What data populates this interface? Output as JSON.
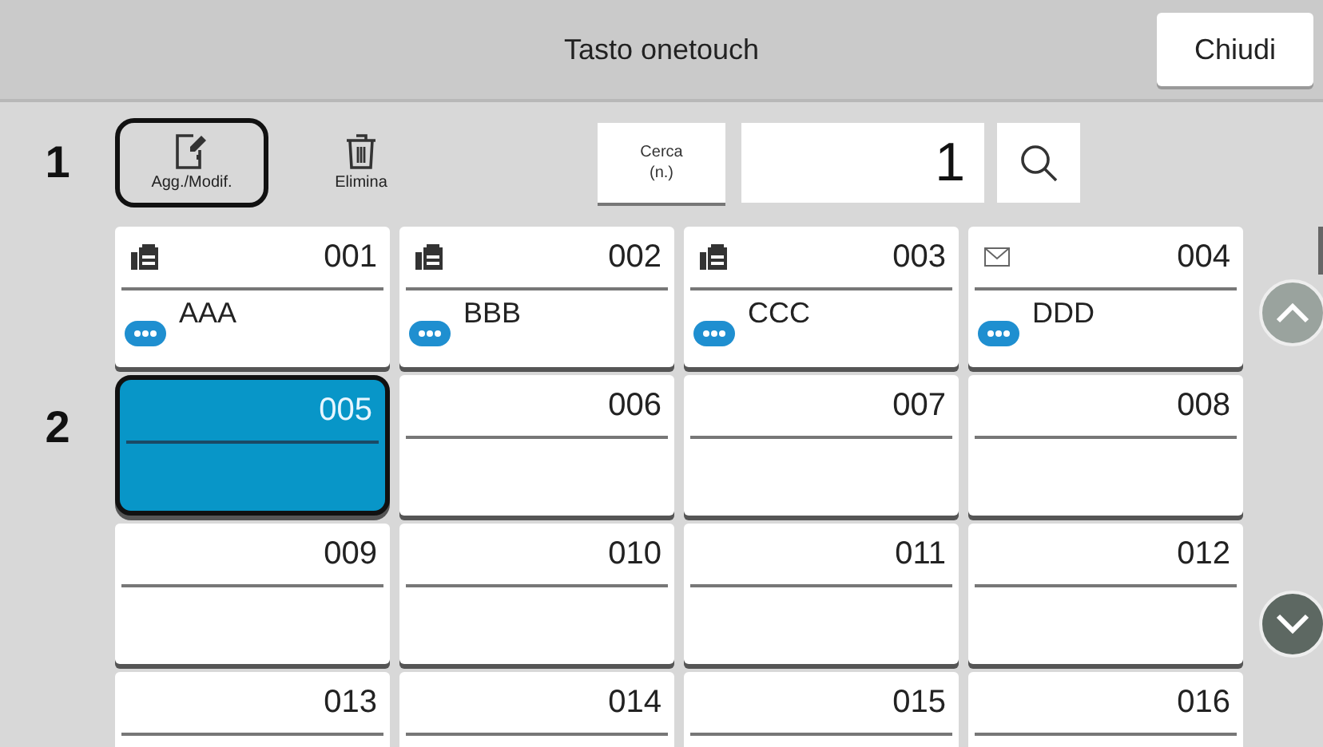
{
  "header": {
    "title": "Tasto onetouch",
    "close_button": "Chiudi"
  },
  "toolbar": {
    "callout": "1",
    "edit_button": {
      "label": "Agg./Modif.",
      "outlined": true
    },
    "delete_button": {
      "label": "Elimina",
      "outlined": false
    },
    "search_by_number_button": "Cerca\n(n.)",
    "number_field": {
      "value": "1"
    }
  },
  "tiles_callout": "2",
  "tiles": [
    {
      "number": "001",
      "kind": "fax",
      "name": "AAA",
      "selected": false,
      "outlined": false
    },
    {
      "number": "002",
      "kind": "fax",
      "name": "BBB",
      "selected": false,
      "outlined": false
    },
    {
      "number": "003",
      "kind": "fax",
      "name": "CCC",
      "selected": false,
      "outlined": false
    },
    {
      "number": "004",
      "kind": "email",
      "name": "DDD",
      "selected": false,
      "outlined": false
    },
    {
      "number": "005",
      "kind": "empty",
      "selected": true,
      "outlined": true
    },
    {
      "number": "006",
      "kind": "empty",
      "selected": false,
      "outlined": false
    },
    {
      "number": "007",
      "kind": "empty",
      "selected": false,
      "outlined": false
    },
    {
      "number": "008",
      "kind": "empty",
      "selected": false,
      "outlined": false
    },
    {
      "number": "009",
      "kind": "empty",
      "selected": false,
      "outlined": false
    },
    {
      "number": "010",
      "kind": "empty",
      "selected": false,
      "outlined": false
    },
    {
      "number": "011",
      "kind": "empty",
      "selected": false,
      "outlined": false
    },
    {
      "number": "012",
      "kind": "empty",
      "selected": false,
      "outlined": false
    },
    {
      "number": "013",
      "kind": "empty",
      "selected": false,
      "outlined": false
    },
    {
      "number": "014",
      "kind": "empty",
      "selected": false,
      "outlined": false
    },
    {
      "number": "015",
      "kind": "empty",
      "selected": false,
      "outlined": false
    },
    {
      "number": "016",
      "kind": "empty",
      "selected": false,
      "outlined": false
    }
  ]
}
